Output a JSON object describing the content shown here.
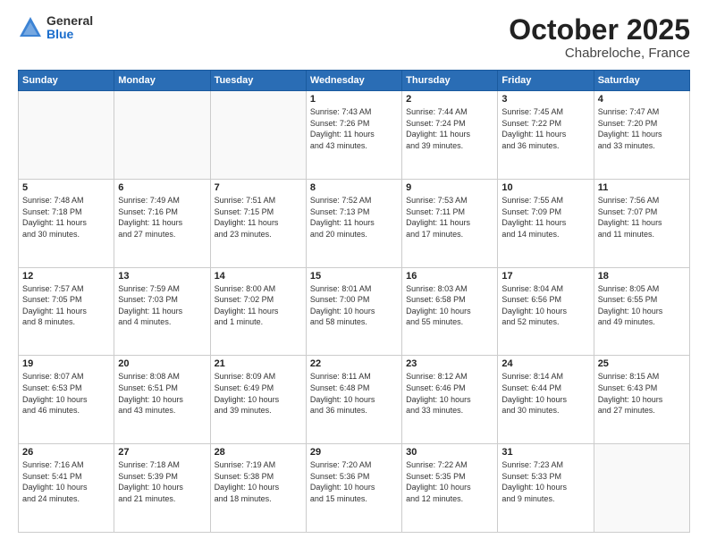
{
  "logo": {
    "general": "General",
    "blue": "Blue"
  },
  "title": "October 2025",
  "location": "Chabreloche, France",
  "days_of_week": [
    "Sunday",
    "Monday",
    "Tuesday",
    "Wednesday",
    "Thursday",
    "Friday",
    "Saturday"
  ],
  "weeks": [
    [
      {
        "day": "",
        "info": ""
      },
      {
        "day": "",
        "info": ""
      },
      {
        "day": "",
        "info": ""
      },
      {
        "day": "1",
        "info": "Sunrise: 7:43 AM\nSunset: 7:26 PM\nDaylight: 11 hours\nand 43 minutes."
      },
      {
        "day": "2",
        "info": "Sunrise: 7:44 AM\nSunset: 7:24 PM\nDaylight: 11 hours\nand 39 minutes."
      },
      {
        "day": "3",
        "info": "Sunrise: 7:45 AM\nSunset: 7:22 PM\nDaylight: 11 hours\nand 36 minutes."
      },
      {
        "day": "4",
        "info": "Sunrise: 7:47 AM\nSunset: 7:20 PM\nDaylight: 11 hours\nand 33 minutes."
      }
    ],
    [
      {
        "day": "5",
        "info": "Sunrise: 7:48 AM\nSunset: 7:18 PM\nDaylight: 11 hours\nand 30 minutes."
      },
      {
        "day": "6",
        "info": "Sunrise: 7:49 AM\nSunset: 7:16 PM\nDaylight: 11 hours\nand 27 minutes."
      },
      {
        "day": "7",
        "info": "Sunrise: 7:51 AM\nSunset: 7:15 PM\nDaylight: 11 hours\nand 23 minutes."
      },
      {
        "day": "8",
        "info": "Sunrise: 7:52 AM\nSunset: 7:13 PM\nDaylight: 11 hours\nand 20 minutes."
      },
      {
        "day": "9",
        "info": "Sunrise: 7:53 AM\nSunset: 7:11 PM\nDaylight: 11 hours\nand 17 minutes."
      },
      {
        "day": "10",
        "info": "Sunrise: 7:55 AM\nSunset: 7:09 PM\nDaylight: 11 hours\nand 14 minutes."
      },
      {
        "day": "11",
        "info": "Sunrise: 7:56 AM\nSunset: 7:07 PM\nDaylight: 11 hours\nand 11 minutes."
      }
    ],
    [
      {
        "day": "12",
        "info": "Sunrise: 7:57 AM\nSunset: 7:05 PM\nDaylight: 11 hours\nand 8 minutes."
      },
      {
        "day": "13",
        "info": "Sunrise: 7:59 AM\nSunset: 7:03 PM\nDaylight: 11 hours\nand 4 minutes."
      },
      {
        "day": "14",
        "info": "Sunrise: 8:00 AM\nSunset: 7:02 PM\nDaylight: 11 hours\nand 1 minute."
      },
      {
        "day": "15",
        "info": "Sunrise: 8:01 AM\nSunset: 7:00 PM\nDaylight: 10 hours\nand 58 minutes."
      },
      {
        "day": "16",
        "info": "Sunrise: 8:03 AM\nSunset: 6:58 PM\nDaylight: 10 hours\nand 55 minutes."
      },
      {
        "day": "17",
        "info": "Sunrise: 8:04 AM\nSunset: 6:56 PM\nDaylight: 10 hours\nand 52 minutes."
      },
      {
        "day": "18",
        "info": "Sunrise: 8:05 AM\nSunset: 6:55 PM\nDaylight: 10 hours\nand 49 minutes."
      }
    ],
    [
      {
        "day": "19",
        "info": "Sunrise: 8:07 AM\nSunset: 6:53 PM\nDaylight: 10 hours\nand 46 minutes."
      },
      {
        "day": "20",
        "info": "Sunrise: 8:08 AM\nSunset: 6:51 PM\nDaylight: 10 hours\nand 43 minutes."
      },
      {
        "day": "21",
        "info": "Sunrise: 8:09 AM\nSunset: 6:49 PM\nDaylight: 10 hours\nand 39 minutes."
      },
      {
        "day": "22",
        "info": "Sunrise: 8:11 AM\nSunset: 6:48 PM\nDaylight: 10 hours\nand 36 minutes."
      },
      {
        "day": "23",
        "info": "Sunrise: 8:12 AM\nSunset: 6:46 PM\nDaylight: 10 hours\nand 33 minutes."
      },
      {
        "day": "24",
        "info": "Sunrise: 8:14 AM\nSunset: 6:44 PM\nDaylight: 10 hours\nand 30 minutes."
      },
      {
        "day": "25",
        "info": "Sunrise: 8:15 AM\nSunset: 6:43 PM\nDaylight: 10 hours\nand 27 minutes."
      }
    ],
    [
      {
        "day": "26",
        "info": "Sunrise: 7:16 AM\nSunset: 5:41 PM\nDaylight: 10 hours\nand 24 minutes."
      },
      {
        "day": "27",
        "info": "Sunrise: 7:18 AM\nSunset: 5:39 PM\nDaylight: 10 hours\nand 21 minutes."
      },
      {
        "day": "28",
        "info": "Sunrise: 7:19 AM\nSunset: 5:38 PM\nDaylight: 10 hours\nand 18 minutes."
      },
      {
        "day": "29",
        "info": "Sunrise: 7:20 AM\nSunset: 5:36 PM\nDaylight: 10 hours\nand 15 minutes."
      },
      {
        "day": "30",
        "info": "Sunrise: 7:22 AM\nSunset: 5:35 PM\nDaylight: 10 hours\nand 12 minutes."
      },
      {
        "day": "31",
        "info": "Sunrise: 7:23 AM\nSunset: 5:33 PM\nDaylight: 10 hours\nand 9 minutes."
      },
      {
        "day": "",
        "info": ""
      }
    ]
  ]
}
